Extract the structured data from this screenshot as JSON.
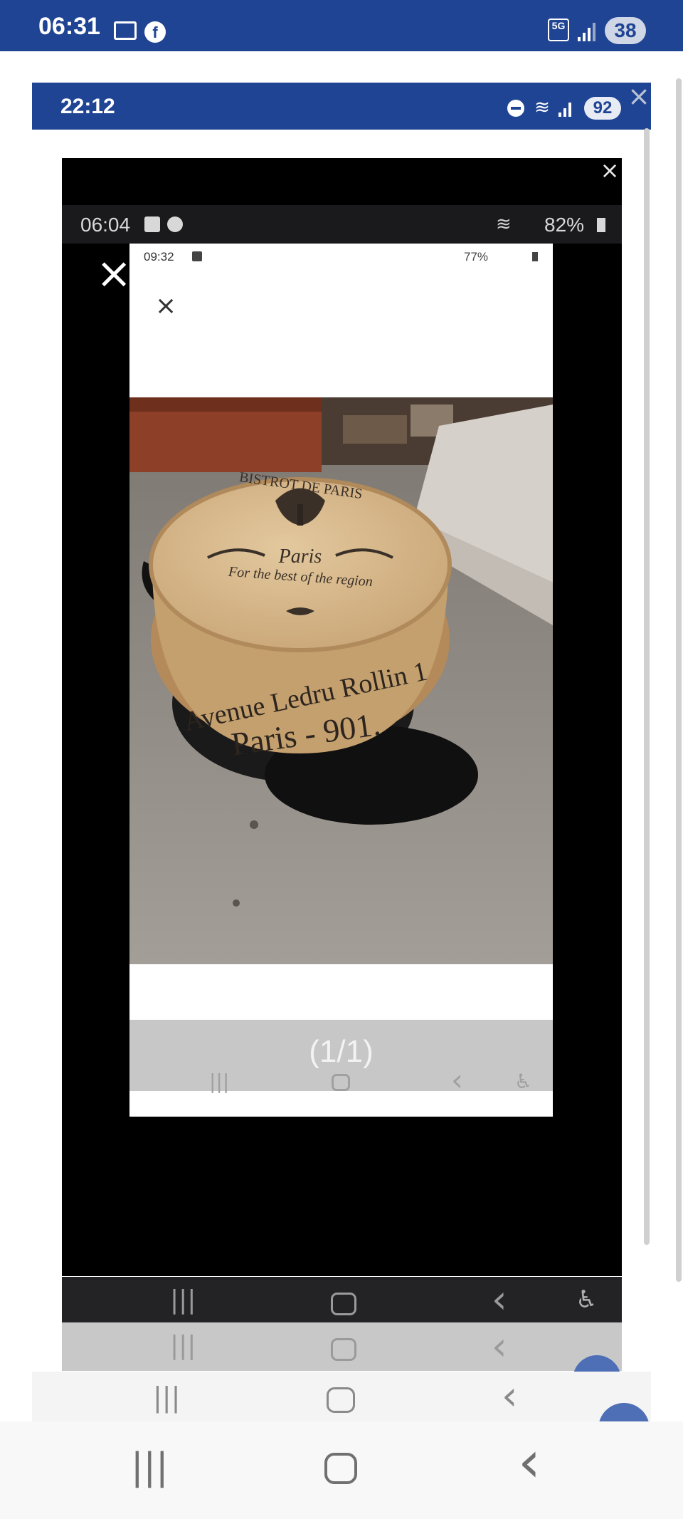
{
  "outer_status": {
    "time": "06:31",
    "network": "5G",
    "battery": "38",
    "bg_color": "#1f4493",
    "icons": [
      "notification-icon",
      "facebook-icon",
      "signal-icon"
    ]
  },
  "frame2": {
    "status_time": "22:12",
    "battery": "92",
    "close_label": "×"
  },
  "viewer3": {
    "status_time": "06:04",
    "battery": "82%",
    "close_label": "×",
    "top_close_label": "×"
  },
  "card4": {
    "status_time": "09:32",
    "battery": "77%",
    "close_label": "×",
    "pager_label": "(1/1)"
  },
  "photo_text": {
    "header": "BISTROT DE PARIS",
    "city": "Paris",
    "tagline": "For the best of the region",
    "address": "Avenue Ledru Rollin 1",
    "number": "Paris - 901."
  },
  "nav": {
    "recents": "|||",
    "home": "○",
    "back": "‹",
    "accessibility": "♿"
  }
}
